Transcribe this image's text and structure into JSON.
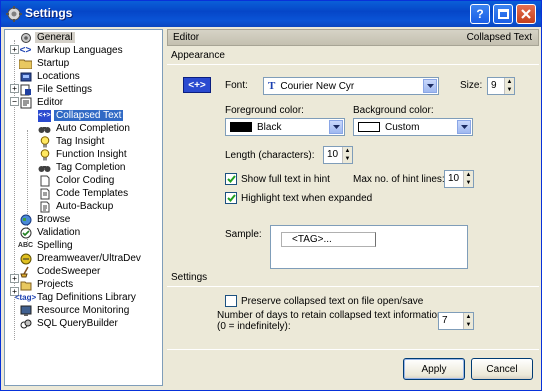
{
  "window": {
    "title": "Settings"
  },
  "tree": {
    "items": [
      {
        "label": "General",
        "icon": "settings-icon"
      },
      {
        "label": "Markup Languages",
        "icon": "markup-icon"
      },
      {
        "label": "Startup",
        "icon": "folder-icon"
      },
      {
        "label": "Locations",
        "icon": "locations-icon"
      },
      {
        "label": "File Settings",
        "icon": "file-settings-icon"
      },
      {
        "label": "Editor",
        "icon": "editor-icon"
      },
      {
        "label": "Collapsed Text",
        "icon": "collapsed-text-icon"
      },
      {
        "label": "Auto Completion",
        "icon": "binoculars-icon"
      },
      {
        "label": "Tag Insight",
        "icon": "bulb-icon"
      },
      {
        "label": "Function Insight",
        "icon": "bulb-icon"
      },
      {
        "label": "Tag Completion",
        "icon": "binoculars-icon"
      },
      {
        "label": "Color Coding",
        "icon": "document-icon"
      },
      {
        "label": "Code Templates",
        "icon": "document-icon"
      },
      {
        "label": "Auto-Backup",
        "icon": "document-icon"
      },
      {
        "label": "Browse",
        "icon": "globe-icon"
      },
      {
        "label": "Validation",
        "icon": "validation-icon"
      },
      {
        "label": "Spelling",
        "icon": "spelling-icon"
      },
      {
        "label": "Dreamweaver/UltraDev",
        "icon": "dreamweaver-icon"
      },
      {
        "label": "CodeSweeper",
        "icon": "codesweeper-icon"
      },
      {
        "label": "Projects",
        "icon": "projects-icon"
      },
      {
        "label": "Tag Definitions Library",
        "icon": "tag-library-icon"
      },
      {
        "label": "Resource Monitoring",
        "icon": "monitor-icon"
      },
      {
        "label": "SQL QueryBuilder",
        "icon": "sql-icon"
      }
    ]
  },
  "header": {
    "left": "Editor",
    "right": "Collapsed Text"
  },
  "appearance": {
    "section_label": "Appearance",
    "preview_icon_text": "<+>",
    "font_label": "Font:",
    "font_value": "Courier New Cyr",
    "size_label": "Size:",
    "size_value": "9",
    "fg_label": "Foreground color:",
    "fg_value": "Black",
    "fg_swatch": "#000000",
    "bg_label": "Background color:",
    "bg_value": "Custom",
    "bg_swatch": "#ffffff",
    "length_label": "Length (characters):",
    "length_value": "10",
    "show_full_label": "Show full text in hint",
    "show_full_checked": true,
    "max_hint_label": "Max no. of hint lines:",
    "max_hint_value": "10",
    "highlight_label": "Highlight text when expanded",
    "highlight_checked": true,
    "sample_label": "Sample:",
    "sample_text": "<TAG>..."
  },
  "settings": {
    "section_label": "Settings",
    "preserve_label": "Preserve collapsed text on file open/save",
    "preserve_checked": false,
    "retain_label_1": "Number of days to retain collapsed text information",
    "retain_label_2": "(0 = indefinitely):",
    "retain_value": "7"
  },
  "buttons": {
    "apply": "Apply",
    "cancel": "Cancel"
  },
  "colors": {
    "titlebar": "#0a54d6",
    "selection": "#316ac5",
    "face": "#ece9d8"
  }
}
